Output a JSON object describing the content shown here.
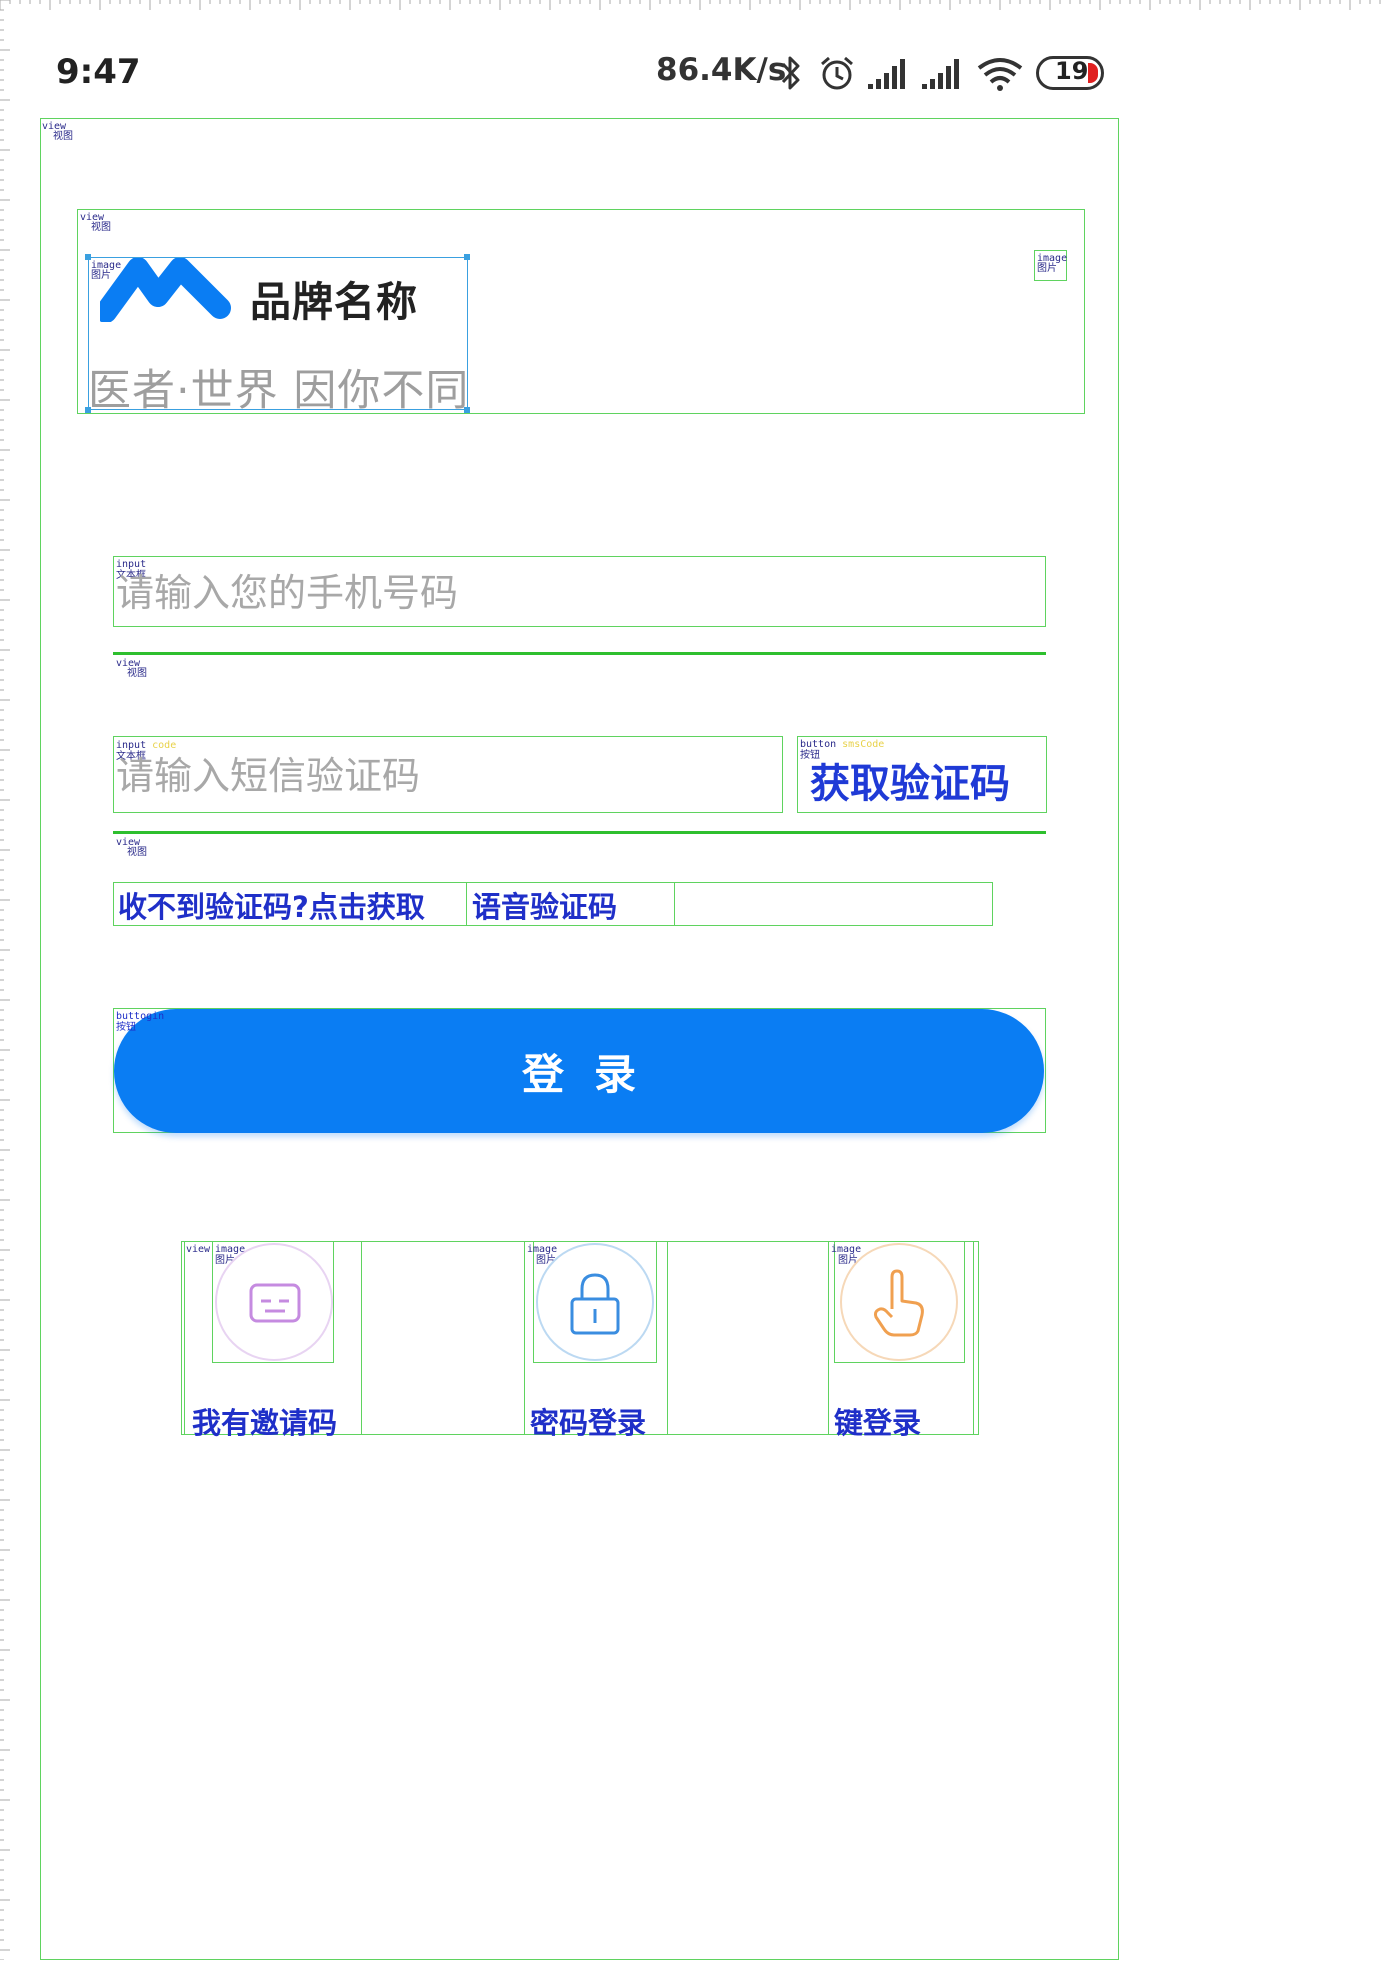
{
  "status_bar": {
    "time": "9:47",
    "net_speed": "86.4K/s",
    "battery": "19",
    "icons": [
      "bluetooth-icon",
      "alarm-icon",
      "signal-icon",
      "signal-icon",
      "wifi-icon",
      "battery-icon"
    ]
  },
  "brand": {
    "name": "品牌名称",
    "slogan": "医者·世界  因你不同",
    "logo_color": "#0a7df3"
  },
  "form": {
    "phone": {
      "placeholder": "请输入您的手机号码",
      "value": ""
    },
    "sms_code": {
      "placeholder": "请输入短信验证码",
      "value": ""
    },
    "get_code_label": "获取验证码",
    "hint": "收不到验证码?点击获取",
    "voice_code_label": "语音验证码",
    "login_label": "登录"
  },
  "login_options": [
    {
      "label": "我有邀请码",
      "icon": "message-icon",
      "color": "#c58be0"
    },
    {
      "label": "密码登录",
      "icon": "lock-icon",
      "color": "#3a8de0"
    },
    {
      "label": "键登录",
      "icon": "hand-pointer-icon",
      "color": "#f0a050"
    }
  ],
  "debug_tags": {
    "view": "view",
    "view_sub": "视图",
    "image": "image",
    "image_sub": "图片",
    "input": "input",
    "input_sub": "文本框",
    "button": "button",
    "button_sub": "按钮",
    "sms_tag": "smsCode",
    "code_tag": "code",
    "login_tag": "buttogin"
  },
  "colors": {
    "accent": "#0a7df3",
    "link": "#1f2fc8",
    "divider": "#2ebf2e",
    "placeholder": "#a8a8a8"
  }
}
